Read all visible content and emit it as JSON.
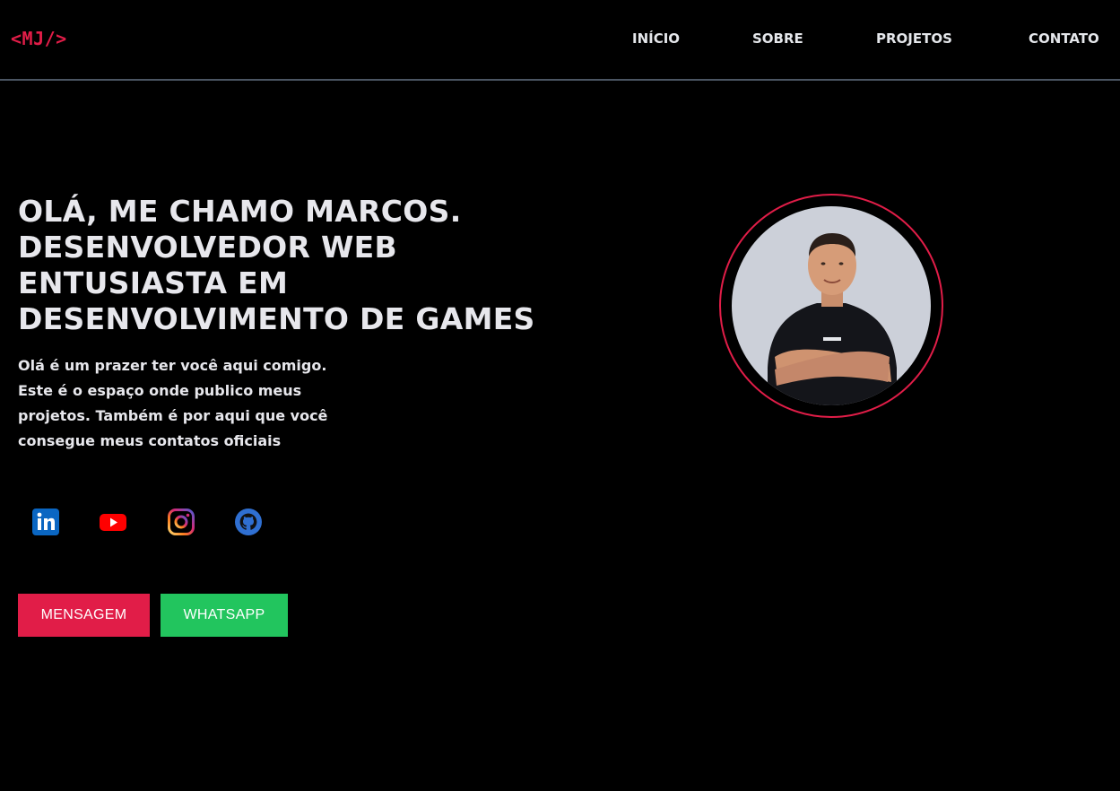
{
  "header": {
    "logo": "<MJ/>",
    "nav": [
      {
        "label": "INÍCIO"
      },
      {
        "label": "SOBRE"
      },
      {
        "label": "PROJETOS"
      },
      {
        "label": "CONTATO"
      }
    ]
  },
  "hero": {
    "title_lines": [
      "OLÁ, ME CHAMO MARCOS.",
      "DESENVOLVEDOR WEB",
      "ENTUSIASTA EM",
      "DESENVOLVIMENTO DE GAMES"
    ],
    "intro_lines": [
      "Olá é um prazer ter você aqui comigo.",
      "Este é o espaço onde publico meus",
      "projetos. Também é por aqui que você",
      "consegue meus contatos oficiais"
    ],
    "socials": [
      {
        "icon": "linkedin-icon"
      },
      {
        "icon": "youtube-icon"
      },
      {
        "icon": "instagram-icon"
      },
      {
        "icon": "github-icon"
      }
    ],
    "buttons": {
      "message": {
        "label": "MENSAGEM",
        "color": "#e11d48"
      },
      "whatsapp": {
        "label": "WHATSAPP",
        "color": "#22c55e"
      }
    }
  },
  "profile": {
    "ring_color": "#e11d48"
  },
  "colors": {
    "background": "#000000",
    "accent": "#e11d48",
    "text": "#e7e7ec"
  }
}
